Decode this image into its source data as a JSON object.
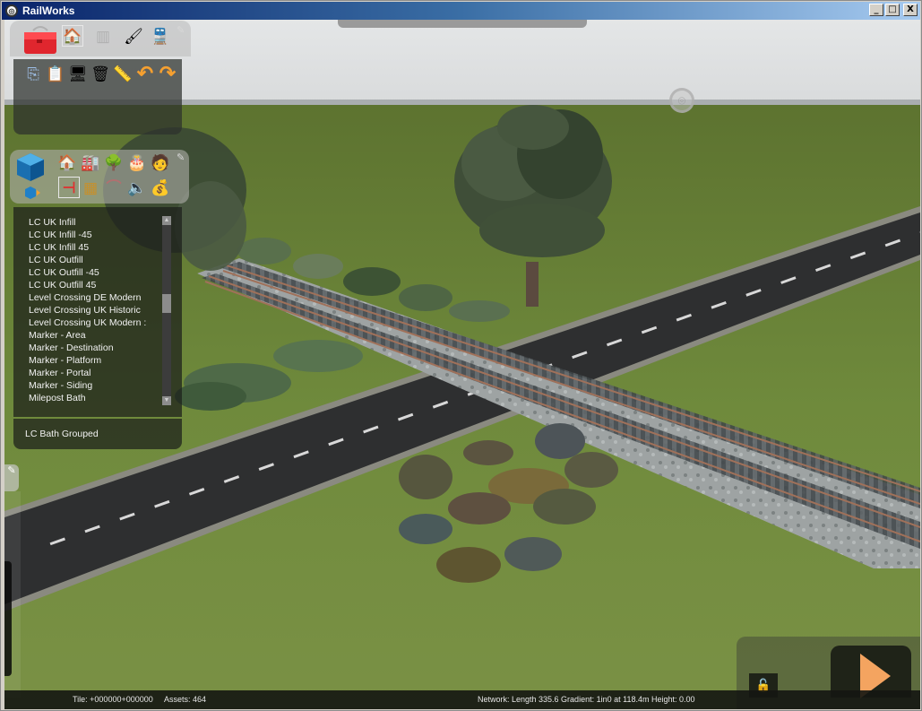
{
  "window": {
    "title": "RailWorks",
    "app_icon": "railworks-logo-icon",
    "controls": {
      "minimize": "_",
      "maximize": "□",
      "close": "X"
    }
  },
  "tools_panel": {
    "tabs": [
      {
        "name": "toolbox",
        "icon": "toolbox-icon",
        "glyph": "🧰"
      },
      {
        "name": "home",
        "icon": "home-icon",
        "glyph": "🏠",
        "selected": true
      },
      {
        "name": "track",
        "icon": "track-icon",
        "glyph": "▥"
      },
      {
        "name": "paint",
        "icon": "paintbrush-icon",
        "glyph": "🖌"
      },
      {
        "name": "train",
        "icon": "train-icon",
        "glyph": "🚆"
      }
    ],
    "tools": [
      {
        "name": "copy",
        "icon": "copy-icon",
        "glyph": "⎘"
      },
      {
        "name": "paste",
        "icon": "paste-icon",
        "glyph": "📋"
      },
      {
        "name": "monitor",
        "icon": "monitor-icon",
        "glyph": "🖥"
      },
      {
        "name": "delete",
        "icon": "trash-icon",
        "glyph": "🗑"
      },
      {
        "name": "measure",
        "icon": "tape-measure-icon",
        "glyph": "📏"
      },
      {
        "name": "undo",
        "icon": "undo-icon",
        "glyph": "↶"
      },
      {
        "name": "redo",
        "icon": "redo-icon",
        "glyph": "↷"
      }
    ]
  },
  "objects_panel": {
    "category_row1": [
      {
        "name": "buildings",
        "icon": "house-icon",
        "glyph": "🏠"
      },
      {
        "name": "industry",
        "icon": "factory-icon",
        "glyph": "🏭"
      },
      {
        "name": "vegetation",
        "icon": "tree-icon",
        "glyph": "🌳"
      },
      {
        "name": "textures",
        "icon": "texture-icon",
        "glyph": "🎂"
      },
      {
        "name": "people",
        "icon": "person-icon",
        "glyph": "🧑"
      }
    ],
    "category_row2": [
      {
        "name": "signals",
        "icon": "signal-icon",
        "glyph": "⊣",
        "selected": true
      },
      {
        "name": "platforms",
        "icon": "platform-icon",
        "glyph": "▦"
      },
      {
        "name": "bridges",
        "icon": "bridge-icon",
        "glyph": "⌒"
      },
      {
        "name": "sounds",
        "icon": "speaker-icon",
        "glyph": "🔈"
      },
      {
        "name": "misc",
        "icon": "sack-icon",
        "glyph": "💰"
      }
    ],
    "items": [
      "LC UK Infill",
      "LC UK Infill -45",
      "LC UK Infill 45",
      "LC UK Outfill",
      "LC UK Outfill -45",
      "LC UK Outfill 45",
      "Level Crossing DE Modern",
      "Level Crossing UK Historic",
      "Level Crossing UK Modern :",
      "Marker - Area",
      "Marker - Destination",
      "Marker - Platform",
      "Marker - Portal",
      "Marker - Siding",
      "Milepost Bath"
    ],
    "scroll_position": 0.45,
    "selected_object": "LC Bath Grouped"
  },
  "status": {
    "tile": "Tile: +000000+000000",
    "assets": "Assets: 464",
    "network": "Network:  Length  335.6 Gradient: 1in0 at 118.4m Height:   0.00"
  },
  "controls": {
    "lock_glyph": "🔓",
    "play_icon": "play-icon"
  },
  "colors": {
    "play_accent": "#f4a460",
    "titlebar_start": "#0a246a",
    "titlebar_end": "#a6caf0",
    "grass": "#6f8a3c",
    "sky": "#dfe1e2",
    "road": "#2e2f30"
  }
}
